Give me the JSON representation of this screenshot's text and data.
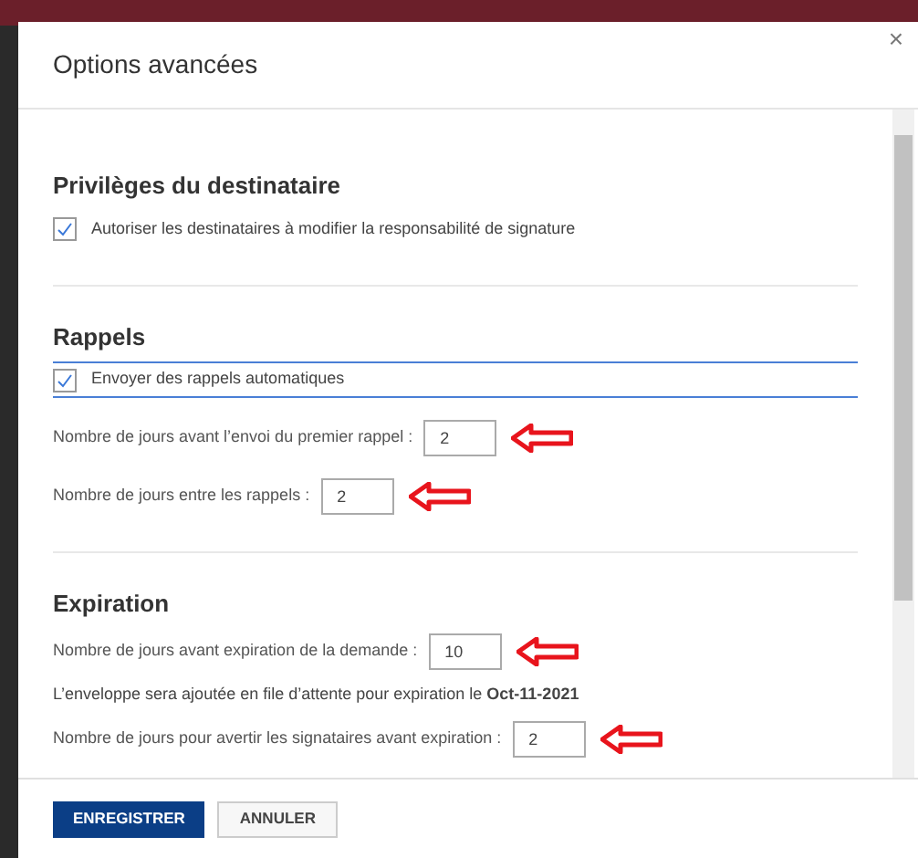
{
  "dialog": {
    "title": "Options avancées",
    "close": "×"
  },
  "sections": [
    {
      "heading": "Privilèges du destinataire",
      "items": [
        {
          "kind": "checkbox",
          "label": "Autoriser les destinataires à modifier la responsabilité de signature",
          "checked": true,
          "focused": false
        }
      ]
    },
    {
      "heading": "Rappels",
      "items": [
        {
          "kind": "checkbox",
          "label": "Envoyer des rappels automatiques",
          "checked": true,
          "focused": true
        },
        {
          "kind": "number",
          "label": "Nombre de jours avant l’envoi du premier rappel :",
          "value": "2",
          "annotated": true
        },
        {
          "kind": "number",
          "label": "Nombre de jours entre les rappels :",
          "value": "2",
          "annotated": true
        }
      ]
    },
    {
      "heading": "Expiration",
      "items": [
        {
          "kind": "number",
          "label": "Nombre de jours avant expiration de la demande :",
          "value": "10",
          "annotated": true
        },
        {
          "kind": "info",
          "text": "L’enveloppe sera ajoutée en file d’attente pour expiration le **Oct-11-2021**"
        },
        {
          "kind": "number",
          "label": "Nombre de jours pour avertir les signataires avant expiration :",
          "value": "2",
          "annotated": true
        }
      ]
    }
  ],
  "buttons": [
    {
      "label": "ENREGISTRER",
      "primary": true
    },
    {
      "label": "ANNULER",
      "primary": false
    }
  ]
}
